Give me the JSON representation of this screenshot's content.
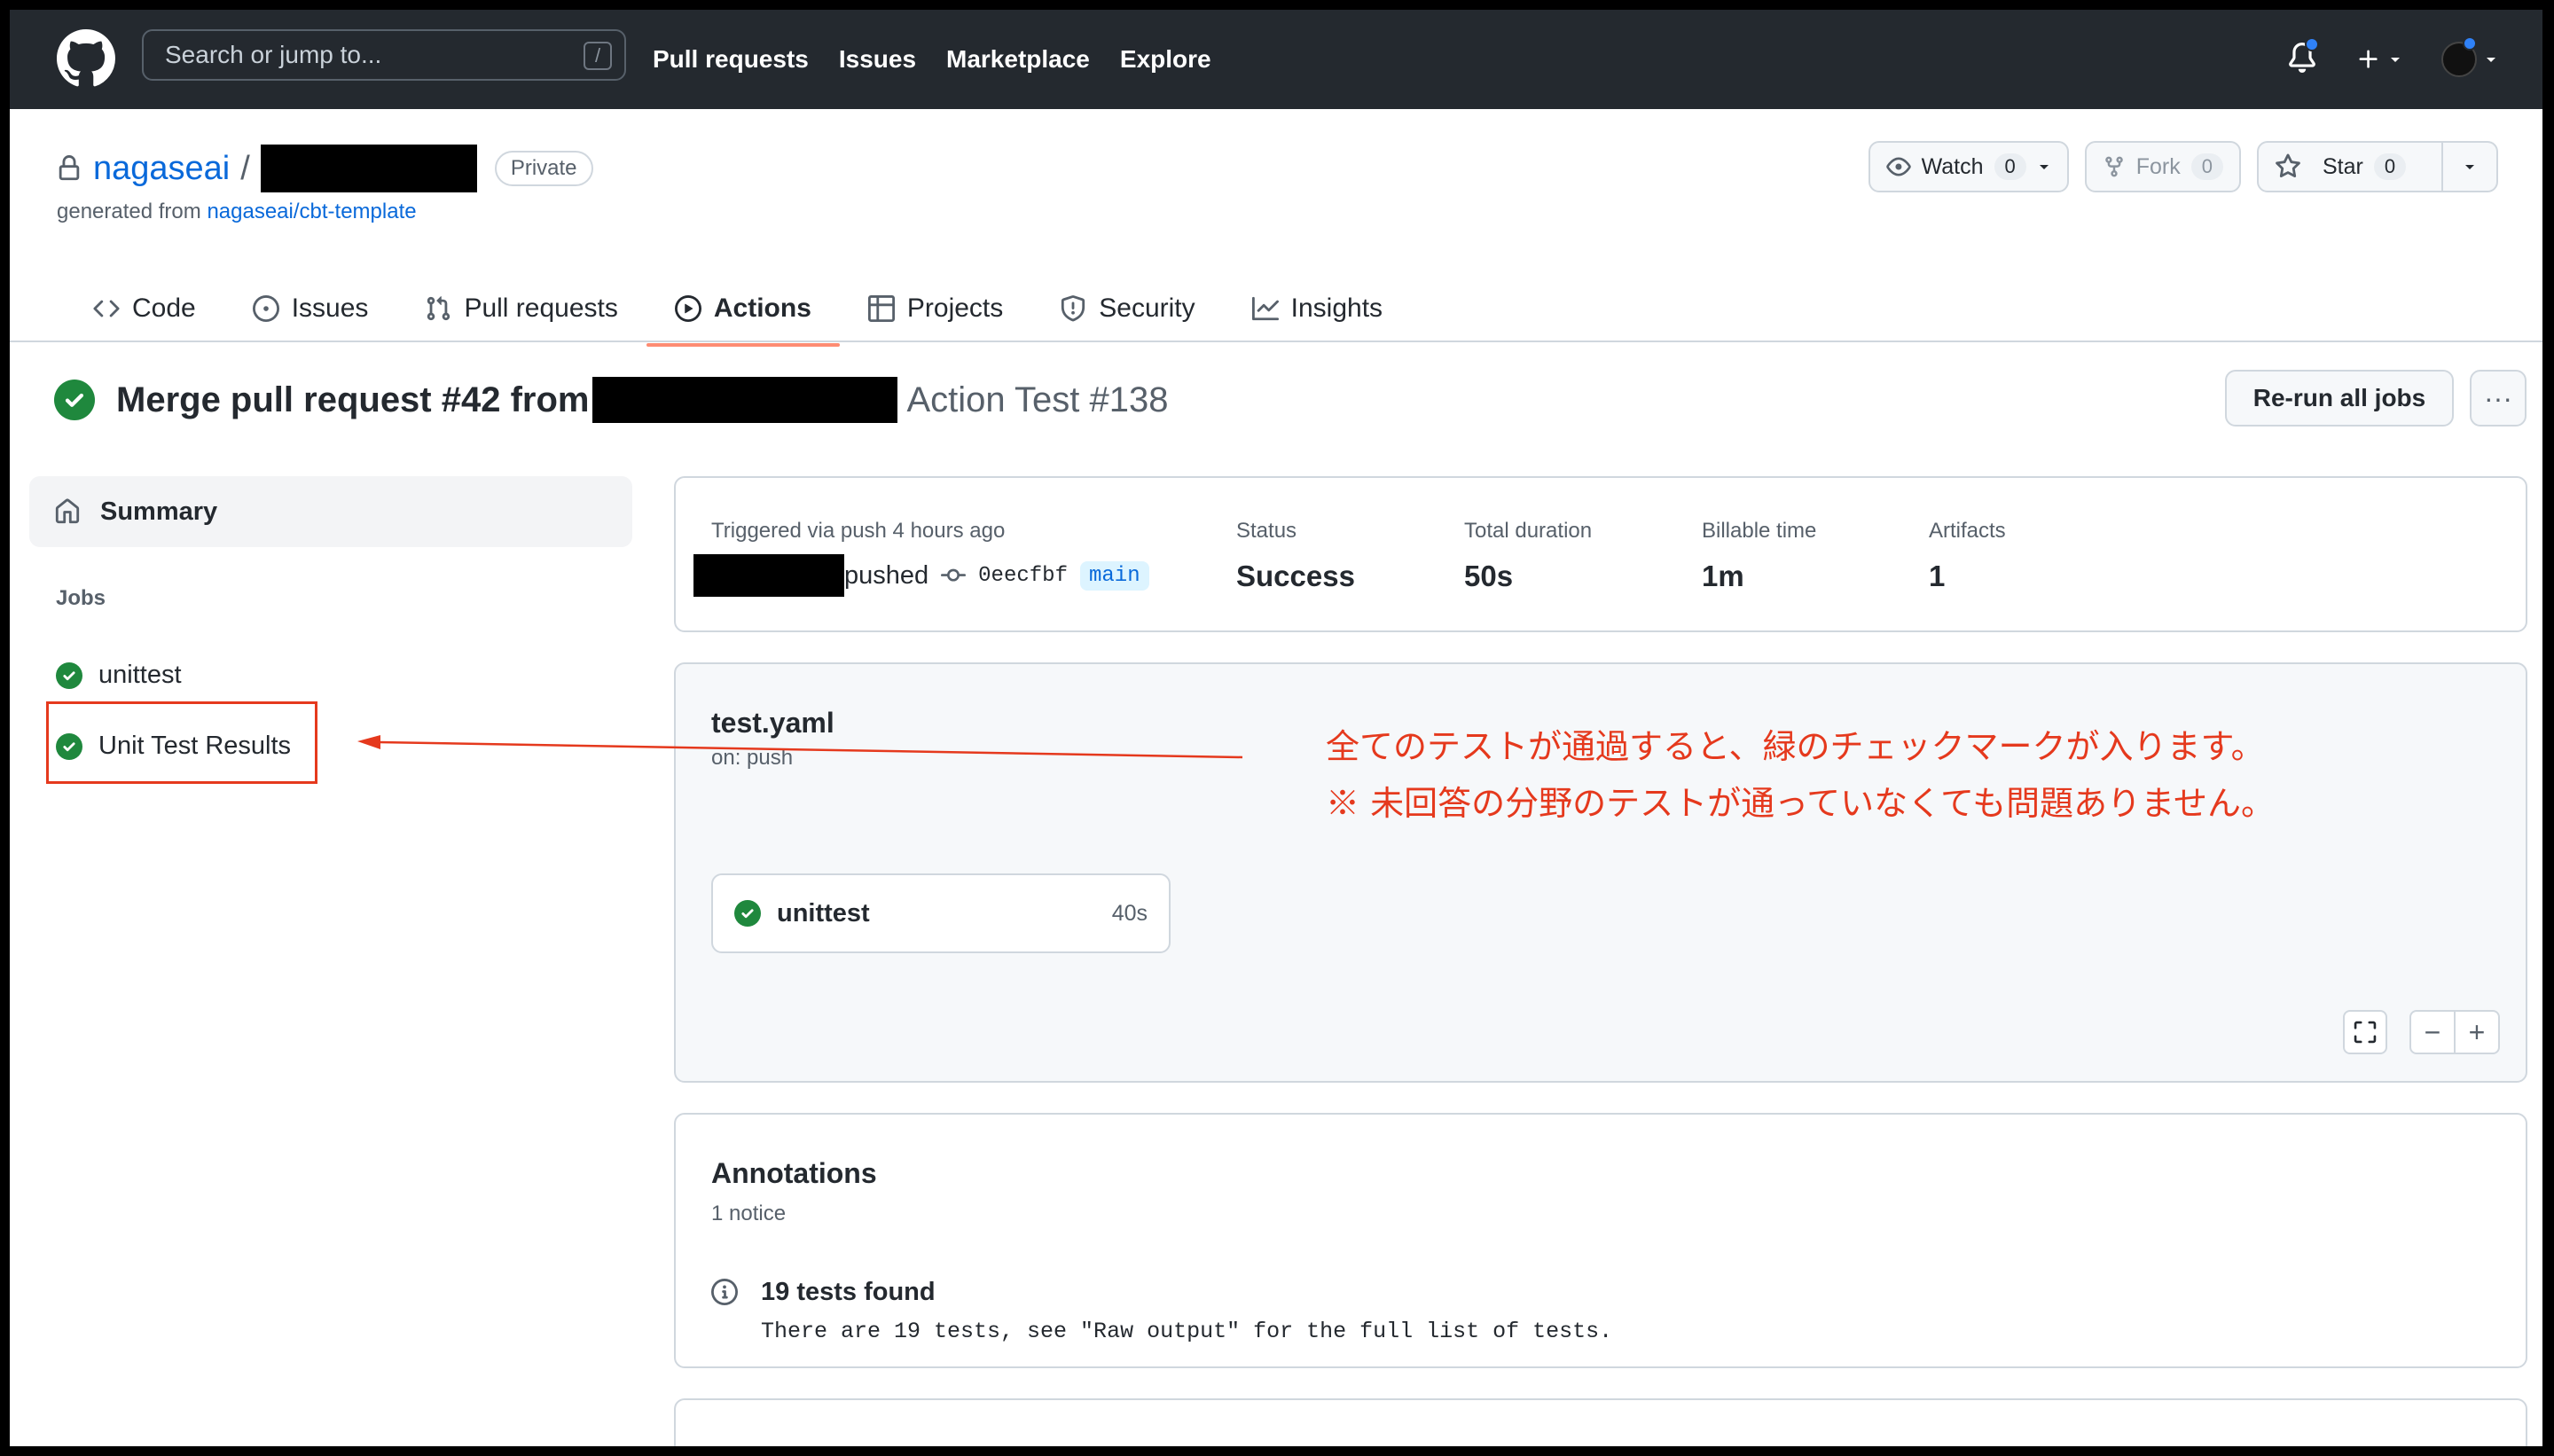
{
  "header": {
    "search_placeholder": "Search or jump to...",
    "search_shortcut": "/",
    "nav": [
      "Pull requests",
      "Issues",
      "Marketplace",
      "Explore"
    ]
  },
  "repo": {
    "owner": "nagaseai",
    "separator": "/",
    "visibility": "Private",
    "generated_from_prefix": "generated from ",
    "generated_from_link": "nagaseai/cbt-template",
    "watch_label": "Watch",
    "watch_count": "0",
    "fork_label": "Fork",
    "fork_count": "0",
    "star_label": "Star",
    "star_count": "0"
  },
  "tabs": [
    {
      "label": "Code",
      "icon": "code-icon"
    },
    {
      "label": "Issues",
      "icon": "issue-opened-icon"
    },
    {
      "label": "Pull requests",
      "icon": "git-pull-request-icon"
    },
    {
      "label": "Actions",
      "icon": "play-icon",
      "active": true
    },
    {
      "label": "Projects",
      "icon": "table-icon"
    },
    {
      "label": "Security",
      "icon": "shield-icon"
    },
    {
      "label": "Insights",
      "icon": "graph-icon"
    }
  ],
  "run": {
    "title": "Merge pull request #42 from",
    "subtitle": "Action Test #138",
    "rerun_label": "Re-run all jobs"
  },
  "sidebar": {
    "summary_label": "Summary",
    "jobs_heading": "Jobs",
    "jobs": [
      {
        "label": "unittest",
        "status": "success"
      },
      {
        "label": "Unit Test Results",
        "status": "success"
      }
    ]
  },
  "summary_panel": {
    "trigger_text": "Triggered via push 4 hours ago",
    "pushed_label": "pushed",
    "commit_sha": "0eecfbf",
    "branch": "main",
    "status_label": "Status",
    "status_value": "Success",
    "duration_label": "Total duration",
    "duration_value": "50s",
    "billable_label": "Billable time",
    "billable_value": "1m",
    "artifacts_label": "Artifacts",
    "artifacts_value": "1"
  },
  "workflow": {
    "file": "test.yaml",
    "trigger": "on: push",
    "job_name": "unittest",
    "job_duration": "40s",
    "zoom_out": "−",
    "zoom_in": "+"
  },
  "annotation_note": {
    "line1": "全てのテストが通過すると、緑のチェックマークが入ります。",
    "line2": "※ 未回答の分野のテストが通っていなくても問題ありません。"
  },
  "annotations": {
    "heading": "Annotations",
    "count": "1 notice",
    "item_title": "19 tests found",
    "item_text": "There are 19 tests, see \"Raw output\" for the full list of tests."
  },
  "colors": {
    "success": "#1f883d",
    "annotation_red": "#e5391d",
    "header_bg": "#24292f",
    "link": "#0969da"
  }
}
